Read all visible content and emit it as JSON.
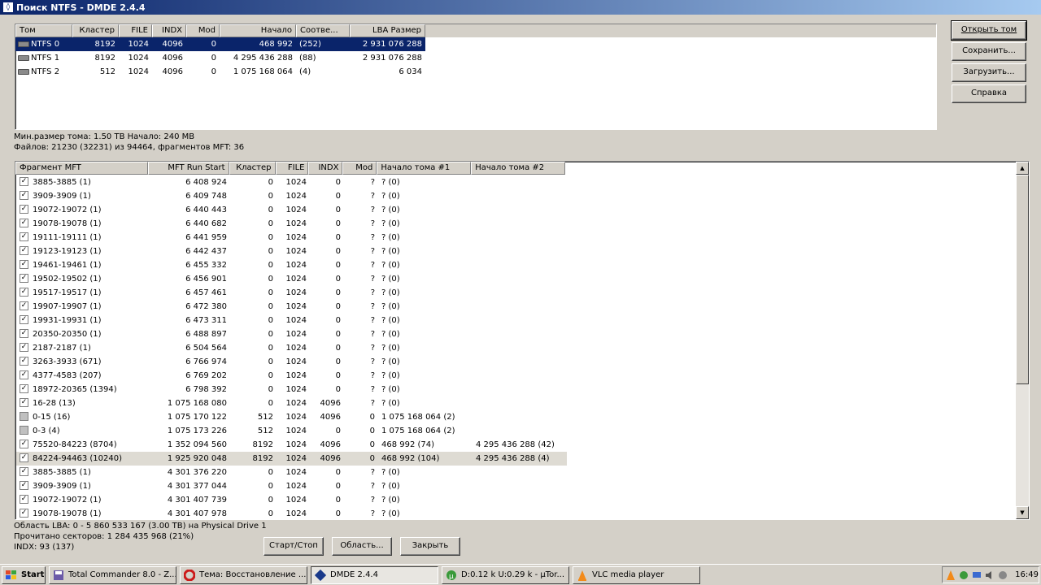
{
  "window": {
    "title": "Поиск NTFS - DMDE 2.4.4"
  },
  "volumes": {
    "headers": [
      "Том",
      "Кластер",
      "FILE",
      "INDX",
      "Mod",
      "Начало",
      "Соотве...",
      "LBA Размер"
    ],
    "rows": [
      [
        "NTFS 0",
        "8192",
        "1024",
        "4096",
        "0",
        "468 992",
        "(252)",
        "2 931 076 288"
      ],
      [
        "NTFS 1",
        "8192",
        "1024",
        "4096",
        "0",
        "4 295 436 288",
        "(88)",
        "2 931 076 288"
      ],
      [
        "NTFS 2",
        "512",
        "1024",
        "4096",
        "0",
        "1 075 168 064",
        "(4)",
        "6 034"
      ]
    ]
  },
  "buttons": {
    "open_volume": "Открыть том",
    "save": "Сохранить...",
    "load": "Загрузить...",
    "help": "Справка",
    "start_stop": "Старт/Стоп",
    "area": "Область...",
    "close": "Закрыть"
  },
  "info": {
    "line1": "Мин.размер тома: 1.50 TB Начало: 240 MB",
    "line2": "Файлов: 21230 (32231) из 94464, фрагментов MFT: 36"
  },
  "fragments": {
    "headers": [
      "Фрагмент MFT",
      "MFT Run Start",
      "Кластер",
      "FILE",
      "INDX",
      "Mod",
      "Начало тома #1",
      "Начало тома #2"
    ],
    "rows": [
      {
        "c": true,
        "v": [
          "3885-3885 (1)",
          "6 408 924",
          "0",
          "1024",
          "0",
          "?",
          "? (0)",
          ""
        ]
      },
      {
        "c": true,
        "v": [
          "3909-3909 (1)",
          "6 409 748",
          "0",
          "1024",
          "0",
          "?",
          "? (0)",
          ""
        ]
      },
      {
        "c": true,
        "v": [
          "19072-19072 (1)",
          "6 440 443",
          "0",
          "1024",
          "0",
          "?",
          "? (0)",
          ""
        ]
      },
      {
        "c": true,
        "v": [
          "19078-19078 (1)",
          "6 440 682",
          "0",
          "1024",
          "0",
          "?",
          "? (0)",
          ""
        ]
      },
      {
        "c": true,
        "v": [
          "19111-19111 (1)",
          "6 441 959",
          "0",
          "1024",
          "0",
          "?",
          "? (0)",
          ""
        ]
      },
      {
        "c": true,
        "v": [
          "19123-19123 (1)",
          "6 442 437",
          "0",
          "1024",
          "0",
          "?",
          "? (0)",
          ""
        ]
      },
      {
        "c": true,
        "v": [
          "19461-19461 (1)",
          "6 455 332",
          "0",
          "1024",
          "0",
          "?",
          "? (0)",
          ""
        ]
      },
      {
        "c": true,
        "v": [
          "19502-19502 (1)",
          "6 456 901",
          "0",
          "1024",
          "0",
          "?",
          "? (0)",
          ""
        ]
      },
      {
        "c": true,
        "v": [
          "19517-19517 (1)",
          "6 457 461",
          "0",
          "1024",
          "0",
          "?",
          "? (0)",
          ""
        ]
      },
      {
        "c": true,
        "v": [
          "19907-19907 (1)",
          "6 472 380",
          "0",
          "1024",
          "0",
          "?",
          "? (0)",
          ""
        ]
      },
      {
        "c": true,
        "v": [
          "19931-19931 (1)",
          "6 473 311",
          "0",
          "1024",
          "0",
          "?",
          "? (0)",
          ""
        ]
      },
      {
        "c": true,
        "v": [
          "20350-20350 (1)",
          "6 488 897",
          "0",
          "1024",
          "0",
          "?",
          "? (0)",
          ""
        ]
      },
      {
        "c": true,
        "v": [
          "2187-2187 (1)",
          "6 504 564",
          "0",
          "1024",
          "0",
          "?",
          "? (0)",
          ""
        ]
      },
      {
        "c": true,
        "v": [
          "3263-3933 (671)",
          "6 766 974",
          "0",
          "1024",
          "0",
          "?",
          "? (0)",
          ""
        ]
      },
      {
        "c": true,
        "v": [
          "4377-4583 (207)",
          "6 769 202",
          "0",
          "1024",
          "0",
          "?",
          "? (0)",
          ""
        ]
      },
      {
        "c": true,
        "v": [
          "18972-20365 (1394)",
          "6 798 392",
          "0",
          "1024",
          "0",
          "?",
          "? (0)",
          ""
        ]
      },
      {
        "c": true,
        "v": [
          "16-28 (13)",
          "1 075 168 080",
          "0",
          "1024",
          "4096",
          "?",
          "? (0)",
          ""
        ]
      },
      {
        "c": false,
        "v": [
          "0-15 (16)",
          "1 075 170 122",
          "512",
          "1024",
          "4096",
          "0",
          "1 075 168 064 (2)",
          ""
        ]
      },
      {
        "c": false,
        "v": [
          "0-3 (4)",
          "1 075 173 226",
          "512",
          "1024",
          "0",
          "0",
          "1 075 168 064 (2)",
          ""
        ]
      },
      {
        "c": true,
        "v": [
          "75520-84223 (8704)",
          "1 352 094 560",
          "8192",
          "1024",
          "4096",
          "0",
          "468 992 (74)",
          "4 295 436 288 (42)"
        ]
      },
      {
        "c": true,
        "v": [
          "84224-94463 (10240)",
          "1 925 920 048",
          "8192",
          "1024",
          "4096",
          "0",
          "468 992 (104)",
          "4 295 436 288 (4)"
        ],
        "hl": true
      },
      {
        "c": true,
        "v": [
          "3885-3885 (1)",
          "4 301 376 220",
          "0",
          "1024",
          "0",
          "?",
          "? (0)",
          ""
        ]
      },
      {
        "c": true,
        "v": [
          "3909-3909 (1)",
          "4 301 377 044",
          "0",
          "1024",
          "0",
          "?",
          "? (0)",
          ""
        ]
      },
      {
        "c": true,
        "v": [
          "19072-19072 (1)",
          "4 301 407 739",
          "0",
          "1024",
          "0",
          "?",
          "? (0)",
          ""
        ]
      },
      {
        "c": true,
        "v": [
          "19078-19078 (1)",
          "4 301 407 978",
          "0",
          "1024",
          "0",
          "?",
          "? (0)",
          ""
        ]
      }
    ]
  },
  "status": {
    "line1": "Область LBA: 0 - 5 860 533 167 (3.00 TB) на Physical Drive 1",
    "line2": "Прочитано секторов: 1 284 435 968 (21%)",
    "line3": "INDX: 93 (137)"
  },
  "taskbar": {
    "start": "Start",
    "tasks": [
      "Total Commander 8.0 - Z...",
      "Тема: Восстановление ...",
      "DMDE 2.4.4",
      "D:0.12 k U:0.29 k - µTor...",
      "VLC media player"
    ],
    "clock": "16:49"
  }
}
